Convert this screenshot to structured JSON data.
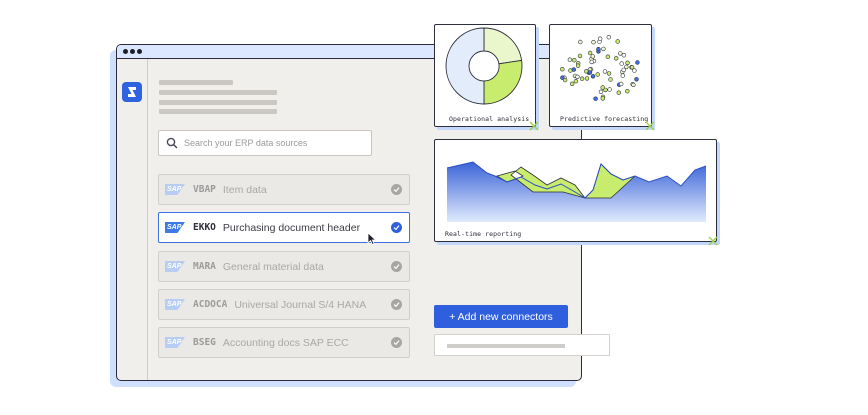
{
  "search": {
    "placeholder": "Search your ERP data sources"
  },
  "data_sources": [
    {
      "logo": "SAP",
      "code": "VBAP",
      "name": "Item data",
      "selected": false
    },
    {
      "logo": "SAP",
      "code": "EKKO",
      "name": "Purchasing document header",
      "selected": true
    },
    {
      "logo": "SAP",
      "code": "MARA",
      "name": "General material data",
      "selected": false
    },
    {
      "logo": "SAP",
      "code": "ACDOCA",
      "name": "Universal Journal S/4 HANA",
      "selected": false
    },
    {
      "logo": "SAP",
      "code": "BSEG",
      "name": "Accounting docs SAP ECC",
      "selected": false
    }
  ],
  "actions": {
    "add_connectors_label": "+ Add new connectors"
  },
  "cards": {
    "operational": {
      "label": "Operational analysis"
    },
    "predictive": {
      "label": "Predictive forecasting"
    },
    "reporting": {
      "label": "Real-time reporting"
    }
  },
  "colors": {
    "accent_blue": "#2f5fdc",
    "lime": "#c8ec6e",
    "pale_lime": "#eaf7cc",
    "pale_blue": "#e2ecfb",
    "window_bg": "#f1efec",
    "titlebar": "#dbe7ff",
    "shadow_blue": "#cfe0ff"
  },
  "icons": {
    "app_logo": "app-logo-icon",
    "search": "search-icon",
    "check": "check-icon",
    "cursor": "cursor-icon",
    "resize": "resize-icon"
  }
}
